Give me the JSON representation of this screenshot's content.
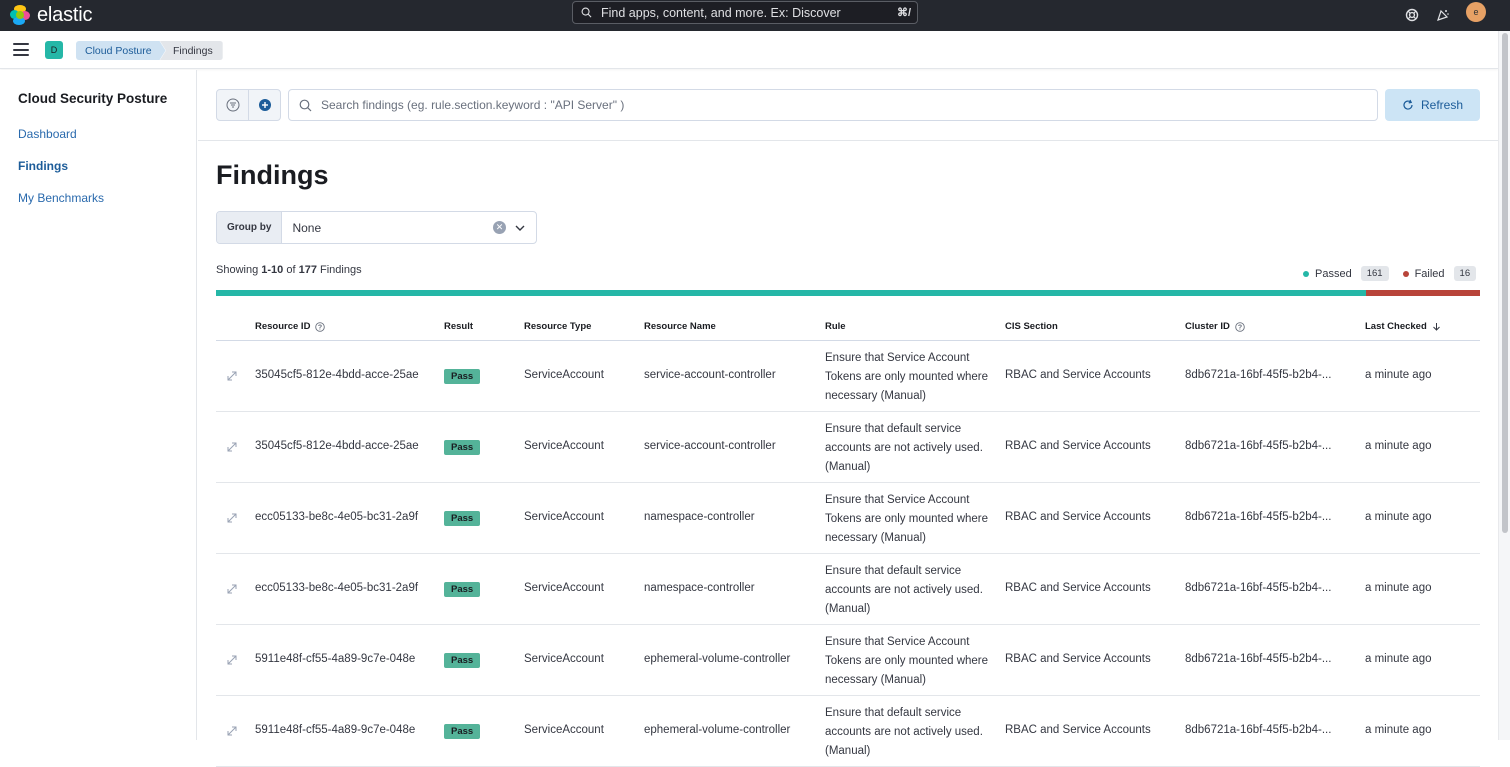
{
  "header": {
    "logo_text": "elastic",
    "search_placeholder": "Find apps, content, and more. Ex: Discover",
    "search_shortcut": "⌘/",
    "avatar_initial": "e"
  },
  "breadcrumbs": {
    "space_badge": "D",
    "items": [
      "Cloud Posture",
      "Findings"
    ]
  },
  "sidebar": {
    "title": "Cloud Security Posture",
    "items": [
      {
        "label": "Dashboard",
        "active": false
      },
      {
        "label": "Findings",
        "active": true
      },
      {
        "label": "My Benchmarks",
        "active": false
      }
    ]
  },
  "search": {
    "placeholder": "Search findings (eg. rule.section.keyword : \"API Server\" )",
    "refresh_label": "Refresh"
  },
  "page_title": "Findings",
  "group_by": {
    "label": "Group by",
    "value": "None"
  },
  "summary": {
    "showing_prefix": "Showing ",
    "range": "1-10",
    "of": " of ",
    "total": "177",
    "suffix": " Findings",
    "passed_label": "Passed",
    "passed_count": "161",
    "failed_label": "Failed",
    "failed_count": "16",
    "passed_fraction": 0.9096,
    "pass_color": "#25b7a7",
    "fail_color": "#b8443a"
  },
  "table": {
    "columns": [
      "Resource ID",
      "Result",
      "Resource Type",
      "Resource Name",
      "Rule",
      "CIS Section",
      "Cluster ID",
      "Last Checked"
    ],
    "rows": [
      {
        "resource_id": "35045cf5-812e-4bdd-acce-25ae",
        "result": "Pass",
        "resource_type": "ServiceAccount",
        "resource_name": "service-account-controller",
        "rule": "Ensure that Service Account Tokens are only mounted where necessary (Manual)",
        "cis_section": "RBAC and Service Accounts",
        "cluster_id": "8db6721a-16bf-45f5-b2b4-...",
        "last_checked": "a minute ago"
      },
      {
        "resource_id": "35045cf5-812e-4bdd-acce-25ae",
        "result": "Pass",
        "resource_type": "ServiceAccount",
        "resource_name": "service-account-controller",
        "rule": "Ensure that default service accounts are not actively used. (Manual)",
        "cis_section": "RBAC and Service Accounts",
        "cluster_id": "8db6721a-16bf-45f5-b2b4-...",
        "last_checked": "a minute ago"
      },
      {
        "resource_id": "ecc05133-be8c-4e05-bc31-2a9f",
        "result": "Pass",
        "resource_type": "ServiceAccount",
        "resource_name": "namespace-controller",
        "rule": "Ensure that Service Account Tokens are only mounted where necessary (Manual)",
        "cis_section": "RBAC and Service Accounts",
        "cluster_id": "8db6721a-16bf-45f5-b2b4-...",
        "last_checked": "a minute ago"
      },
      {
        "resource_id": "ecc05133-be8c-4e05-bc31-2a9f",
        "result": "Pass",
        "resource_type": "ServiceAccount",
        "resource_name": "namespace-controller",
        "rule": "Ensure that default service accounts are not actively used. (Manual)",
        "cis_section": "RBAC and Service Accounts",
        "cluster_id": "8db6721a-16bf-45f5-b2b4-...",
        "last_checked": "a minute ago"
      },
      {
        "resource_id": "5911e48f-cf55-4a89-9c7e-048e",
        "result": "Pass",
        "resource_type": "ServiceAccount",
        "resource_name": "ephemeral-volume-controller",
        "rule": "Ensure that Service Account Tokens are only mounted where necessary (Manual)",
        "cis_section": "RBAC and Service Accounts",
        "cluster_id": "8db6721a-16bf-45f5-b2b4-...",
        "last_checked": "a minute ago"
      },
      {
        "resource_id": "5911e48f-cf55-4a89-9c7e-048e",
        "result": "Pass",
        "resource_type": "ServiceAccount",
        "resource_name": "ephemeral-volume-controller",
        "rule": "Ensure that default service accounts are not actively used. (Manual)",
        "cis_section": "RBAC and Service Accounts",
        "cluster_id": "8db6721a-16bf-45f5-b2b4-...",
        "last_checked": "a minute ago"
      }
    ]
  }
}
